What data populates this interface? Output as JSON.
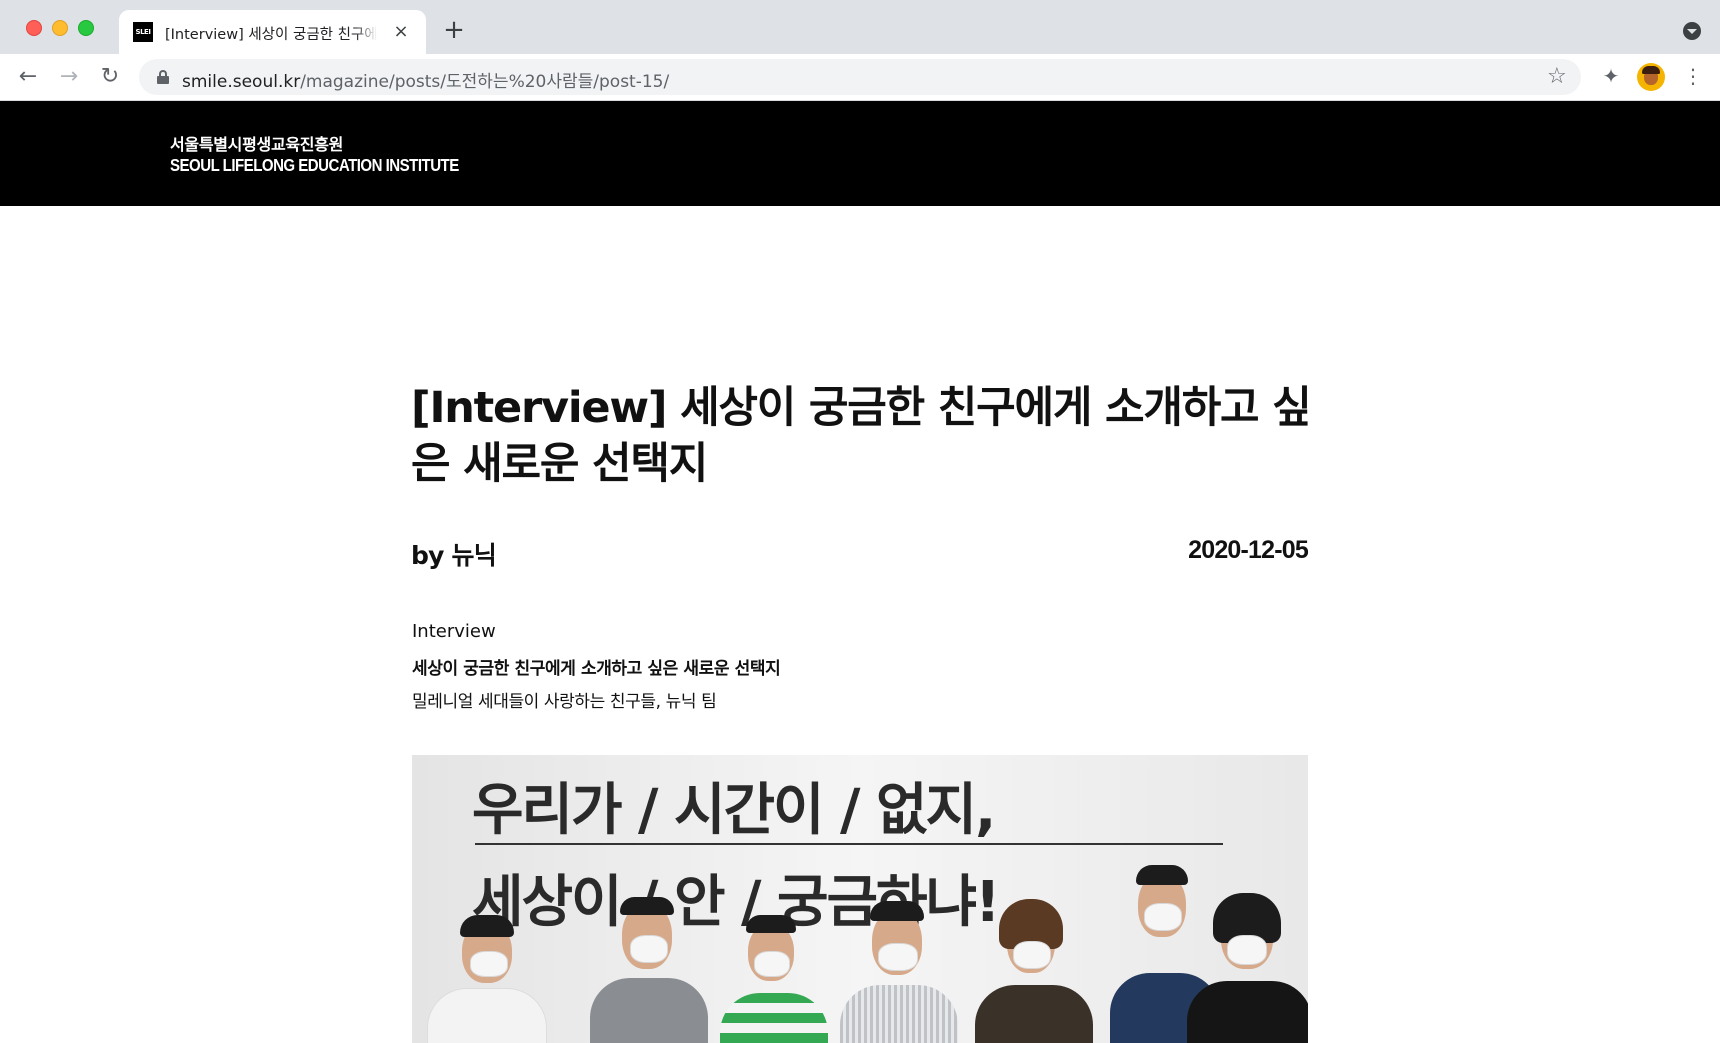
{
  "browser": {
    "tab": {
      "favicon_text": "SLEI",
      "title": "[Interview] 세상이 궁금한 친구에게 소개하고 싶은 새로운 선택지",
      "close_icon": "×"
    },
    "new_tab_icon": "+",
    "url_host": "smile.seoul.kr",
    "url_path": "/magazine/posts/도전하는%20사람들/post-15/",
    "icons": {
      "back": "←",
      "forward": "→",
      "reload": "↻",
      "bookmark": "☆",
      "extensions": "✦",
      "menu": "⋮"
    }
  },
  "site": {
    "brand_ko": "서울특별시평생교육진흥원",
    "brand_en": "SEOUL LIFELONG EDUCATION INSTITUTE",
    "header_bg": "#000000"
  },
  "post": {
    "title": "[Interview] 세상이 궁금한 친구에게 소개하고 싶은 새로운 선택지",
    "byline": "by 뉴닉",
    "date": "2020-12-05",
    "category": "Interview",
    "headline": "세상이 궁금한 친구에게 소개하고 싶은 새로운 선택지",
    "subtitle": "밀레니얼 세대들이 사랑하는 친구들, 뉴닉 팀",
    "photo": {
      "slogan_line1": "우리가 / 시간이 / 없지,",
      "slogan_line2": "세상이 / 안 / 궁금하냐!"
    }
  }
}
